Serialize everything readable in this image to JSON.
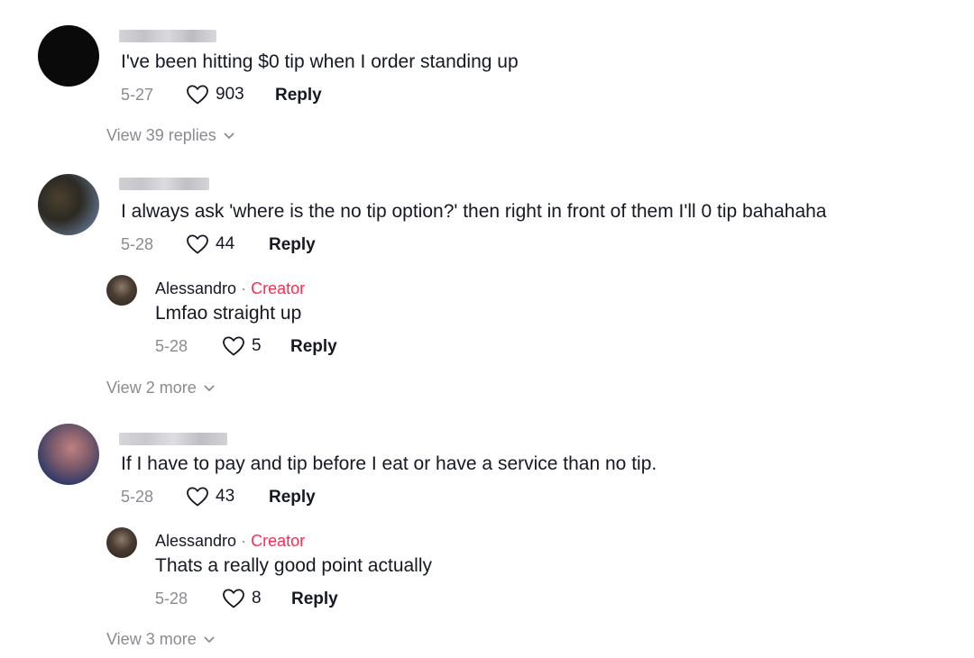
{
  "comments": [
    {
      "text": "I've been hitting $0 tip when I order standing up",
      "date": "5-27",
      "likes": "903",
      "reply_label": "Reply",
      "view_replies": "View 39 replies"
    },
    {
      "text": "I always ask 'where is the no tip option?' then right in front of them I'll 0 tip bahahaha",
      "date": "5-28",
      "likes": "44",
      "reply_label": "Reply",
      "reply": {
        "author": "Alessandro",
        "separator": "·",
        "badge": "Creator",
        "text": "Lmfao straight up",
        "date": "5-28",
        "likes": "5",
        "reply_label": "Reply"
      },
      "view_more": "View 2 more"
    },
    {
      "text": "If I have to pay and tip before I eat or have a service than no tip.",
      "date": "5-28",
      "likes": "43",
      "reply_label": "Reply",
      "reply": {
        "author": "Alessandro",
        "separator": "·",
        "badge": "Creator",
        "text": "Thats a really good point actually",
        "date": "5-28",
        "likes": "8",
        "reply_label": "Reply"
      },
      "view_more": "View 3 more"
    }
  ],
  "colors": {
    "creator": "#fe2c55",
    "muted": "#8a8b91",
    "text": "#161823"
  },
  "icons": {
    "like": "heart-outline-icon",
    "expand": "chevron-down-icon"
  }
}
